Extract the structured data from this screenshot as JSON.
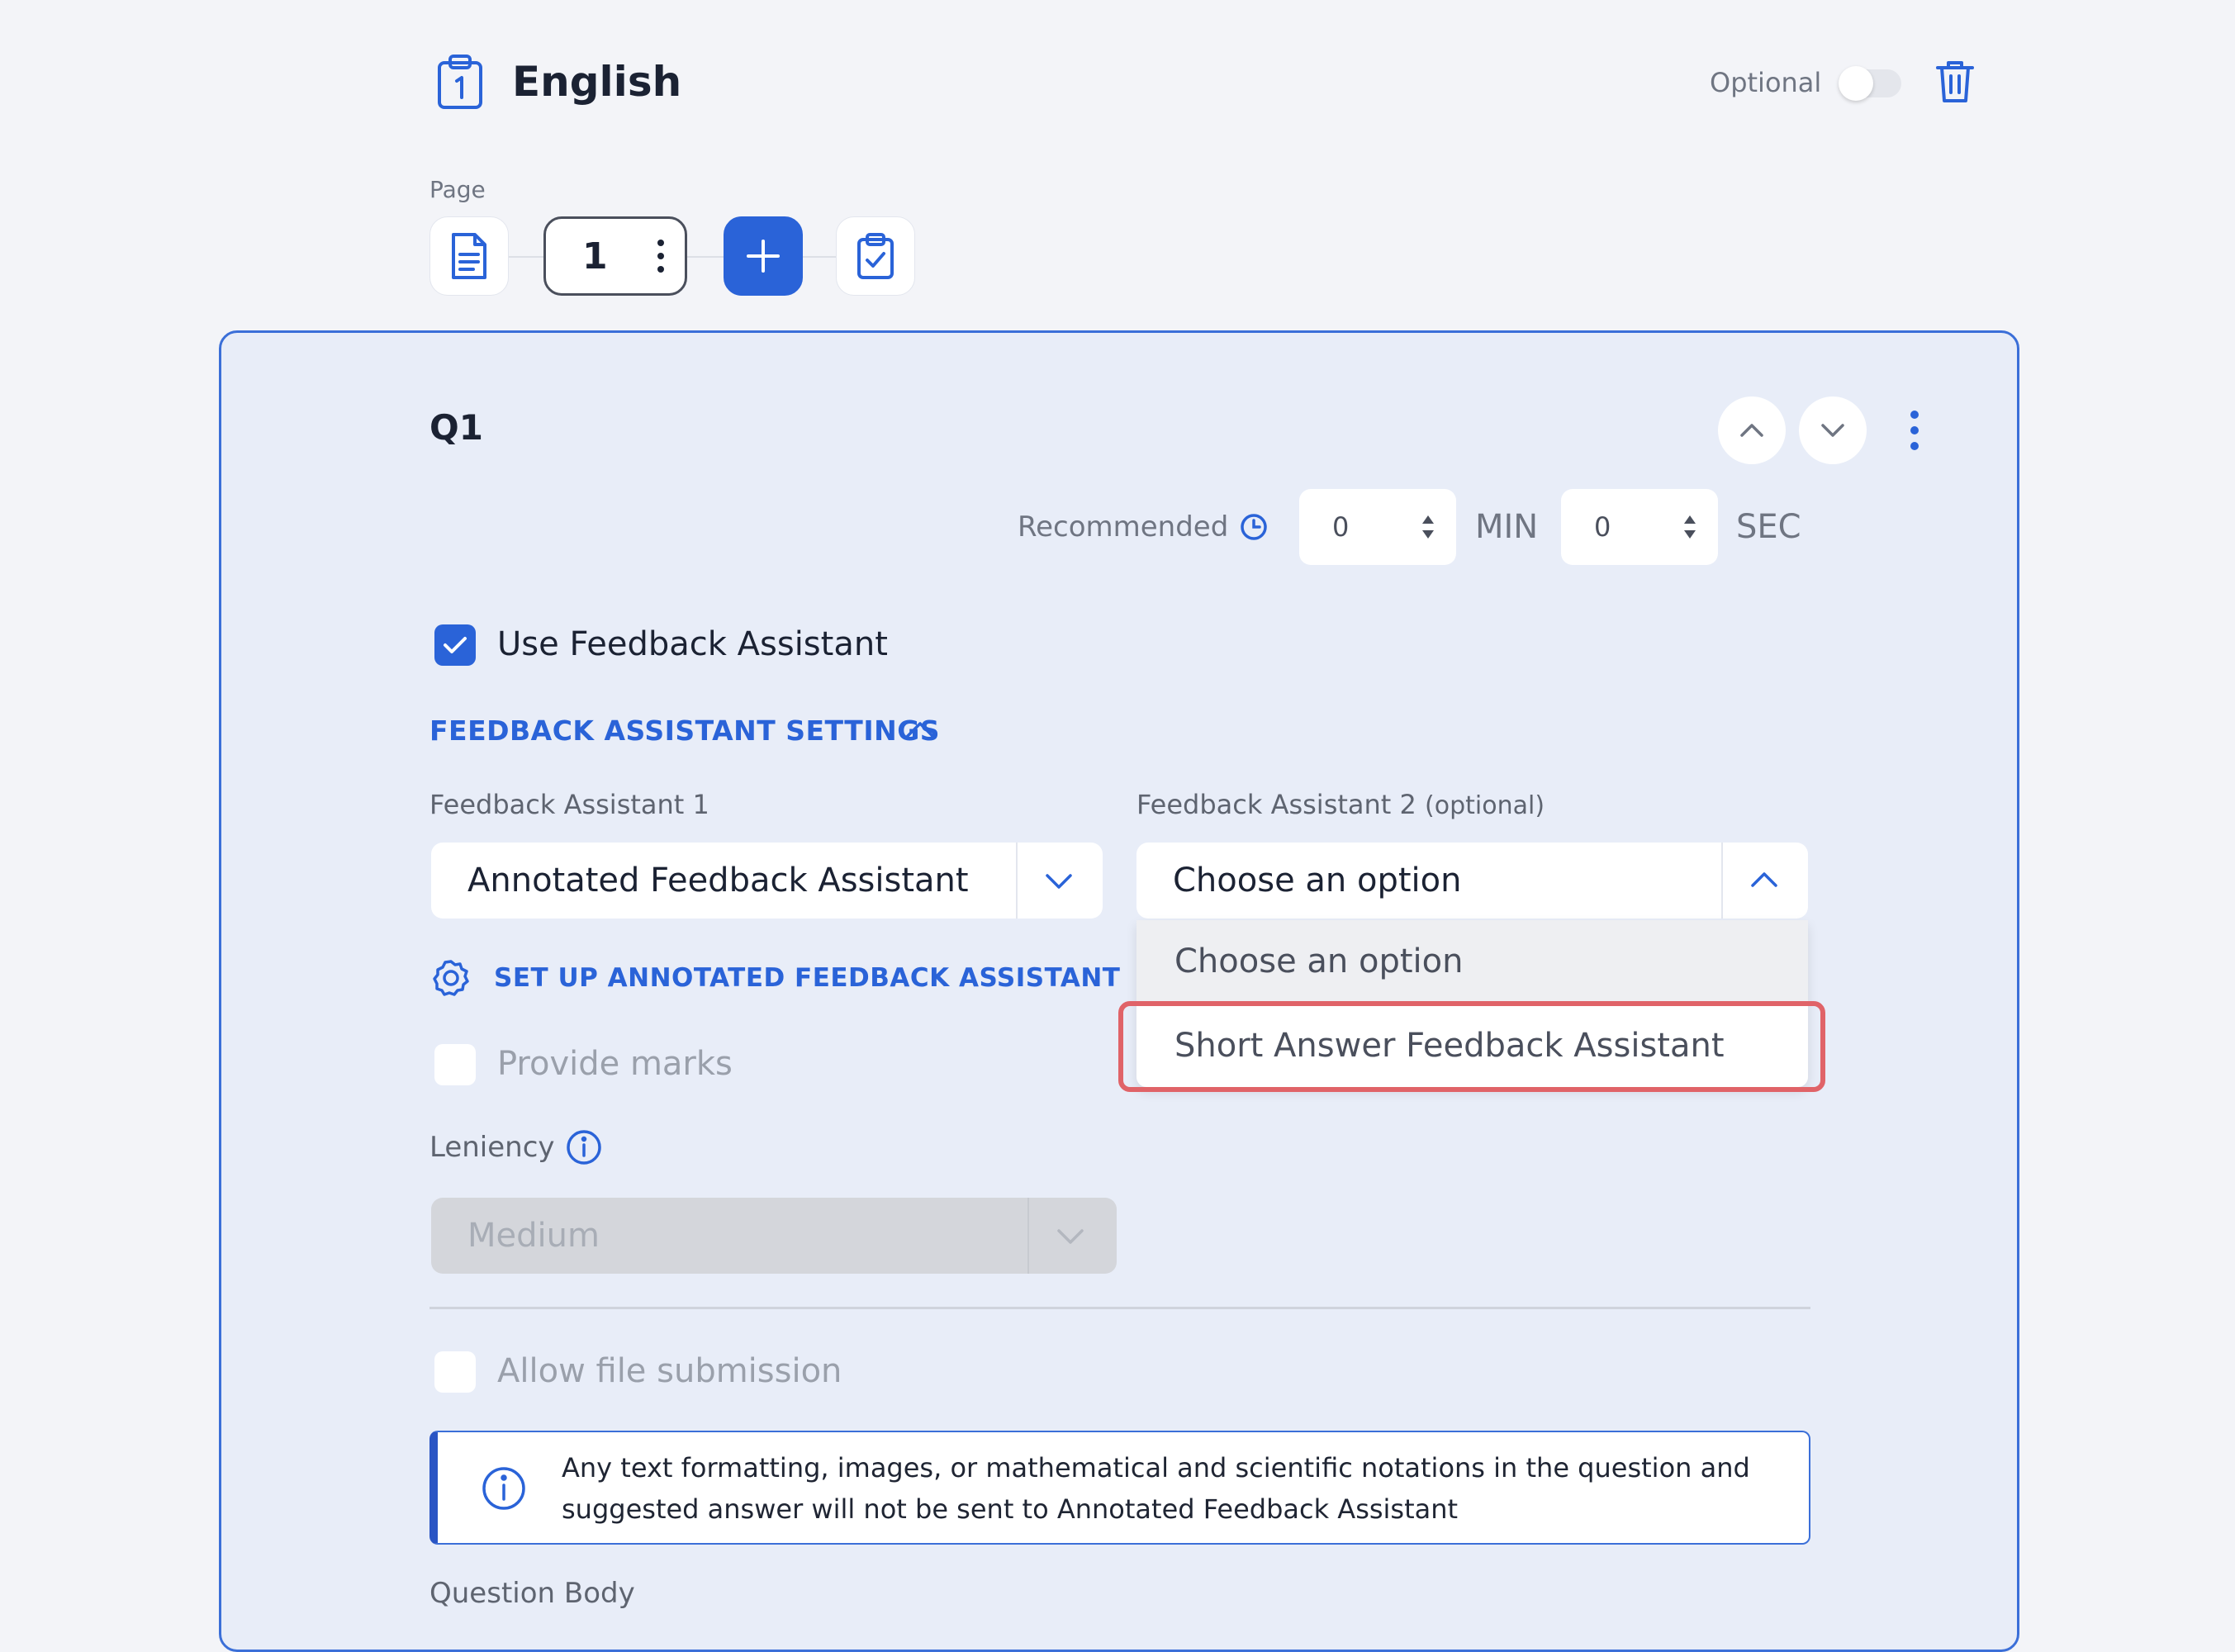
{
  "header": {
    "title": "English",
    "optional_label": "Optional",
    "optional_on": false
  },
  "page_nav": {
    "label": "Page",
    "current_page": "1"
  },
  "question": {
    "label": "Q1",
    "recommended_label": "Recommended",
    "minutes": "0",
    "minutes_unit": "MIN",
    "seconds": "0",
    "seconds_unit": "SEC",
    "use_feedback_assistant": "Use Feedback Assistant",
    "use_feedback_assistant_checked": true,
    "fa_settings_title": "FEEDBACK ASSISTANT SETTINGS",
    "fa1": {
      "label": "Feedback Assistant 1",
      "value": "Annotated Feedback Assistant"
    },
    "fa2": {
      "label": "Feedback Assistant 2",
      "label_suffix": "(optional)",
      "value": "Choose an option",
      "options": [
        "Choose an option",
        "Short Answer Feedback Assistant"
      ]
    },
    "setup_link": "SET UP ANNOTATED FEEDBACK ASSISTANT",
    "provide_marks": "Provide marks",
    "leniency_label": "Leniency",
    "leniency_value": "Medium",
    "allow_file_submission": "Allow file submission",
    "info_text": "Any text formatting, images, or mathematical and scientific notations in the question and suggested answer will not be sent to Annotated Feedback Assistant",
    "question_body_label": "Question Body"
  },
  "colors": {
    "accent": "#2a63d8",
    "highlight": "#e06368",
    "card_bg": "#e8edf8",
    "page_bg": "#f3f4f8"
  },
  "icons": [
    "clipboard-icon",
    "trash-icon",
    "document-icon",
    "kebab-icon",
    "plus-icon",
    "clipboard-check-icon",
    "chevron-up-icon",
    "chevron-down-icon",
    "clock-icon",
    "checkmark-icon",
    "gear-icon",
    "info-icon"
  ]
}
